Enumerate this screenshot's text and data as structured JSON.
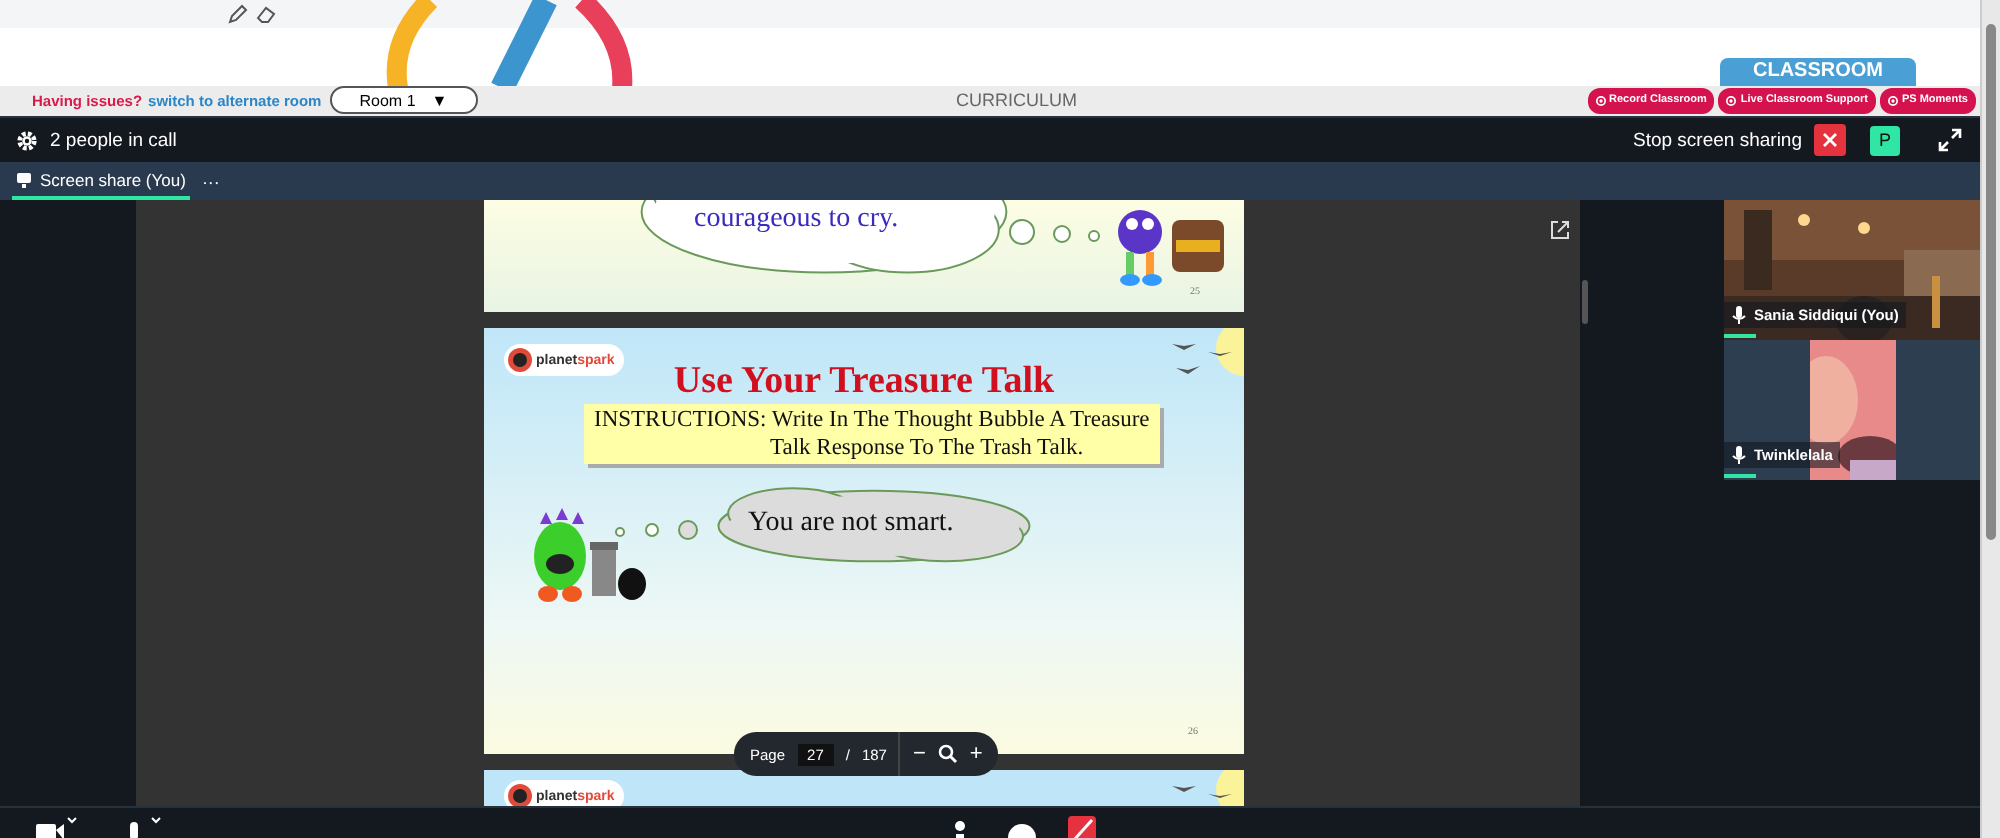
{
  "top_bar": {
    "issue_text": "Having issues?",
    "switch_link": "switch to alternate room",
    "room_select": "Room 1",
    "room_caret": "▼",
    "center_label": "CURRICULUM",
    "classroom_tab": "CLASSROOM",
    "buttons": [
      {
        "label": "Record Classroom"
      },
      {
        "label": "Live Classroom Support"
      },
      {
        "label": "PS Moments"
      }
    ]
  },
  "call_header": {
    "people_count": "2 people in call",
    "stop_sharing": "Stop screen sharing",
    "avatar_letter": "P"
  },
  "tabs": [
    {
      "label": "Screen share (You)",
      "selected": true
    }
  ],
  "tab_more": "···",
  "slides": [
    {
      "kind": "partial_top",
      "bubble_text": "courageous to cry.",
      "page_number": "25"
    },
    {
      "kind": "full",
      "logo": {
        "prefix": "planet",
        "suffix": "spark"
      },
      "title": "Use Your Treasure Talk",
      "instructions": [
        "INSTRUCTIONS: Write In The Thought Bubble A Treasure",
        "Talk Response To The Trash Talk."
      ],
      "bubble_text": "You are not smart.",
      "page_number": "26"
    },
    {
      "kind": "partial_bottom",
      "logo": {
        "prefix": "planet",
        "suffix": "spark"
      }
    }
  ],
  "page_toolbar": {
    "label": "Page",
    "current": "27",
    "separator": "/",
    "total": "187",
    "zoom_out": "−",
    "zoom_in": "+"
  },
  "participants": [
    {
      "kind": "full",
      "name": "Sania Siddiqui (You)"
    },
    {
      "kind": "centered",
      "name": "Twinklelala"
    }
  ]
}
